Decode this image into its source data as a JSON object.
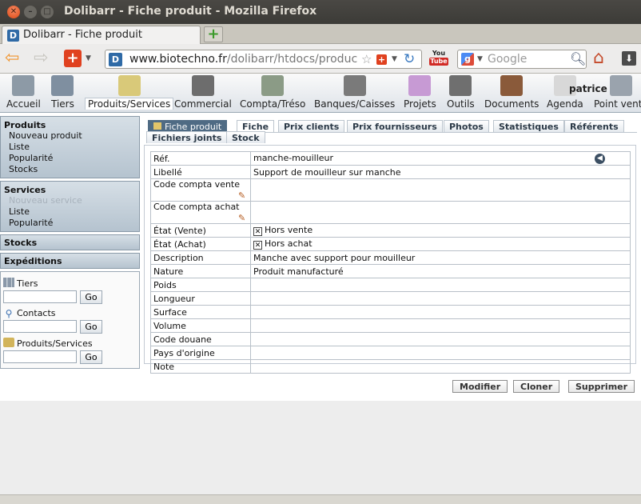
{
  "window": {
    "title": "Dolibarr - Fiche produit - Mozilla Firefox"
  },
  "browser": {
    "tab_title": "Dolibarr - Fiche produit",
    "url_domain": "www.biotechno.fr",
    "url_path": "/dolibarr/htdocs/produc",
    "search_placeholder": "Google",
    "youtube_label": "You",
    "youtube_tube": "Tube",
    "favicon_letter": "D",
    "google_letter": "g",
    "icons": [
      "back-arrow-icon",
      "forward-arrow-icon",
      "addon-plus-icon",
      "star-icon",
      "reload-icon",
      "youtube-icon",
      "google-icon",
      "search-icon",
      "home-icon",
      "download-icon"
    ]
  },
  "topmenu": {
    "items": [
      {
        "label": "Accueil",
        "icon": "home-icon",
        "color": "#8d9aa6"
      },
      {
        "label": "Tiers",
        "icon": "building-icon",
        "color": "#7f8fa0"
      },
      {
        "label": "Produits/Services",
        "icon": "product-icon",
        "color": "#d9c979",
        "selected": true
      },
      {
        "label": "Commercial",
        "icon": "commercial-icon",
        "color": "#6d6d6d"
      },
      {
        "label": "Compta/Tréso",
        "icon": "money-icon",
        "color": "#8b9b86"
      },
      {
        "label": "Banques/Caisses",
        "icon": "bank-icon",
        "color": "#7a7a7a"
      },
      {
        "label": "Projets",
        "icon": "projects-icon",
        "color": "#c79ad4"
      },
      {
        "label": "Outils",
        "icon": "tools-icon",
        "color": "#6f6f6f"
      },
      {
        "label": "Documents",
        "icon": "documents-icon",
        "color": "#8a5a3a"
      },
      {
        "label": "Agenda",
        "icon": "clock-icon",
        "color": "#d8d8d8"
      },
      {
        "label": "Point vente",
        "icon": "cashregister-icon",
        "color": "#9aa3ad"
      }
    ],
    "user": "patrice"
  },
  "leftmenu": {
    "produits": {
      "title": "Produits",
      "items": [
        "Nouveau produit",
        "Liste",
        "Popularité",
        "Stocks"
      ]
    },
    "services": {
      "title": "Services",
      "items": [
        "Nouveau service",
        "Liste",
        "Popularité"
      ]
    },
    "stocks": "Stocks",
    "expeditions": "Expéditions",
    "search": {
      "tiers_label": "Tiers",
      "contacts_label": "Contacts",
      "produits_label": "Produits/Services",
      "go_label": "Go"
    }
  },
  "tabs": {
    "main": "Fiche produit",
    "items": [
      "Fiche",
      "Prix clients",
      "Prix fournisseurs",
      "Photos",
      "Statistiques",
      "Référents",
      "Fichiers joints",
      "Stock"
    ],
    "active": "Fiche"
  },
  "product": {
    "rows": [
      {
        "key": "Réf.",
        "value": "manche-mouilleur"
      },
      {
        "key": "Libellé",
        "value": "Support de mouilleur sur manche"
      },
      {
        "key": "Code compta vente",
        "value": ""
      },
      {
        "key": "Code compta achat",
        "value": ""
      },
      {
        "key": "État (Vente)",
        "value": "Hors vente"
      },
      {
        "key": "État (Achat)",
        "value": "Hors achat"
      },
      {
        "key": "Description",
        "value": "Manche avec support pour mouilleur"
      },
      {
        "key": "Nature",
        "value": "Produit manufacturé"
      },
      {
        "key": "Poids",
        "value": ""
      },
      {
        "key": "Longueur",
        "value": ""
      },
      {
        "key": "Surface",
        "value": ""
      },
      {
        "key": "Volume",
        "value": ""
      },
      {
        "key": "Code douane",
        "value": ""
      },
      {
        "key": "Pays d'origine",
        "value": ""
      },
      {
        "key": "Note",
        "value": ""
      }
    ]
  },
  "actions": {
    "modify": "Modifier",
    "clone": "Cloner",
    "delete": "Supprimer"
  }
}
